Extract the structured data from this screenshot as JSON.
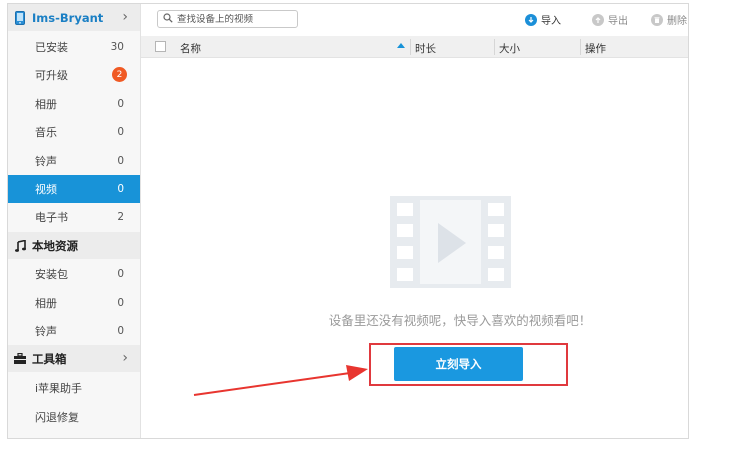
{
  "device": {
    "name": "Ims-Bryant",
    "chevron": "›"
  },
  "device_items": [
    {
      "label": "已安装",
      "count": "30"
    },
    {
      "label": "可升级",
      "badge": "2"
    },
    {
      "label": "相册",
      "count": "0"
    },
    {
      "label": "音乐",
      "count": "0"
    },
    {
      "label": "铃声",
      "count": "0"
    },
    {
      "label": "视频",
      "count": "0",
      "active": true
    },
    {
      "label": "电子书",
      "count": "2"
    }
  ],
  "local": {
    "title": "本地资源"
  },
  "local_items": [
    {
      "label": "安装包",
      "count": "0"
    },
    {
      "label": "相册",
      "count": "0"
    },
    {
      "label": "铃声",
      "count": "0"
    }
  ],
  "tools": {
    "title": "工具箱",
    "chevron": "›"
  },
  "tools_items": [
    {
      "label": "i苹果助手"
    },
    {
      "label": "闪退修复"
    }
  ],
  "toolbar": {
    "search_placeholder": "查找设备上的视频",
    "import": "导入",
    "export": "导出",
    "delete": "删除"
  },
  "table": {
    "columns": [
      "名称",
      "时长",
      "大小",
      "操作"
    ]
  },
  "empty": {
    "message": "设备里还没有视频呢，快导入喜欢的视频看吧！",
    "button": "立刻导入"
  },
  "colors": {
    "accent": "#1893d8",
    "badge": "#f05a24",
    "highlight": "#e0393e"
  }
}
